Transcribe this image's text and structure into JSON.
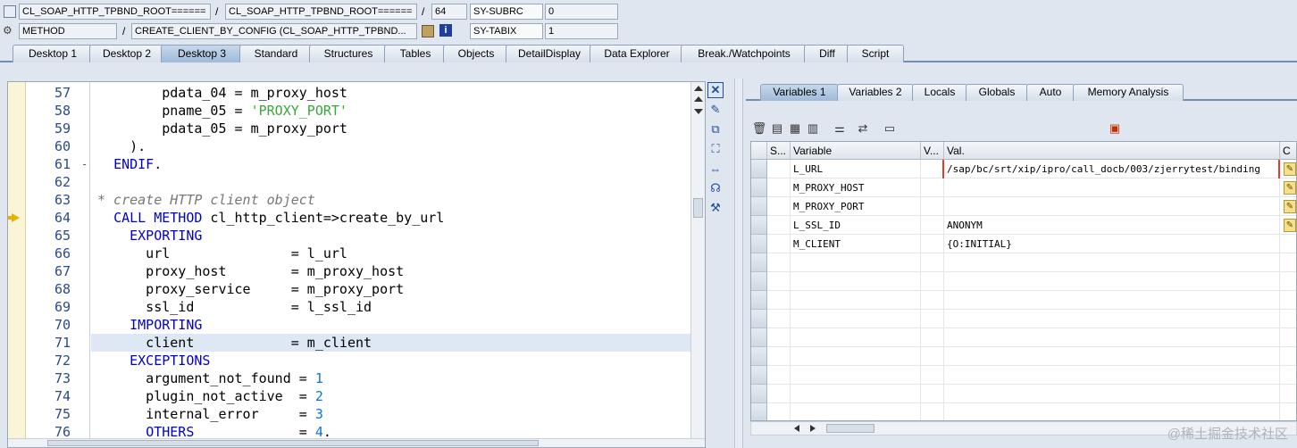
{
  "header": {
    "row1": {
      "program": "CL_SOAP_HTTP_TPBND_ROOT======",
      "include": "CL_SOAP_HTTP_TPBND_ROOT======",
      "line": "64",
      "sysfield": "SY-SUBRC",
      "sysvalue": "0"
    },
    "row2": {
      "event_type": "METHOD",
      "event": "CREATE_CLIENT_BY_CONFIG (CL_SOAP_HTTP_TPBND...",
      "sysfield": "SY-TABIX",
      "sysvalue": "1"
    }
  },
  "desktop_tabs": [
    "Desktop 1",
    "Desktop 2",
    "Desktop 3",
    "Standard",
    "Structures",
    "Tables",
    "Objects",
    "DetailDisplay",
    "Data Explorer",
    "Break./Watchpoints",
    "Diff",
    "Script"
  ],
  "code": {
    "lines": [
      {
        "n": "57",
        "text": "        pdata_04 = m_proxy_host"
      },
      {
        "n": "58",
        "text": "        pname_05 = 'PROXY_PORT'"
      },
      {
        "n": "59",
        "text": "        pdata_05 = m_proxy_port"
      },
      {
        "n": "60",
        "text": "    )."
      },
      {
        "n": "61",
        "text": "  ENDIF."
      },
      {
        "n": "62",
        "text": ""
      },
      {
        "n": "63",
        "text": "* create HTTP client object"
      },
      {
        "n": "64",
        "text": "  CALL METHOD cl_http_client=>create_by_url"
      },
      {
        "n": "65",
        "text": "    EXPORTING"
      },
      {
        "n": "66",
        "text": "      url               = l_url"
      },
      {
        "n": "67",
        "text": "      proxy_host        = m_proxy_host"
      },
      {
        "n": "68",
        "text": "      proxy_service     = m_proxy_port"
      },
      {
        "n": "69",
        "text": "      ssl_id            = l_ssl_id"
      },
      {
        "n": "70",
        "text": "    IMPORTING"
      },
      {
        "n": "71",
        "text": "      client            = m_client"
      },
      {
        "n": "72",
        "text": "    EXCEPTIONS"
      },
      {
        "n": "73",
        "text": "      argument_not_found = 1"
      },
      {
        "n": "74",
        "text": "      plugin_not_active  = 2"
      },
      {
        "n": "75",
        "text": "      internal_error     = 3"
      },
      {
        "n": "76",
        "text": "      OTHERS             = 4."
      }
    ]
  },
  "variables": {
    "tabs": [
      "Variables 1",
      "Variables 2",
      "Locals",
      "Globals",
      "Auto",
      "Memory Analysis"
    ],
    "columns": [
      "S...",
      "Variable",
      "V...",
      "Val."
    ],
    "rows": [
      {
        "variable": "L_URL",
        "value": "/sap/bc/srt/xip/ipro/call_docb/003/zjerrytest/binding"
      },
      {
        "variable": "M_PROXY_HOST",
        "value": ""
      },
      {
        "variable": "M_PROXY_PORT",
        "value": ""
      },
      {
        "variable": "L_SSL_ID",
        "value": "ANONYM"
      },
      {
        "variable": "M_CLIENT",
        "value": "{O:INITIAL}"
      }
    ]
  },
  "watermark": "@稀土掘金技术社区",
  "colors": {
    "keyword": "#0000cd",
    "string": "#3aa53a",
    "comment": "#777777",
    "number": "#0b74d8",
    "active_tab": "#9fbad9"
  }
}
